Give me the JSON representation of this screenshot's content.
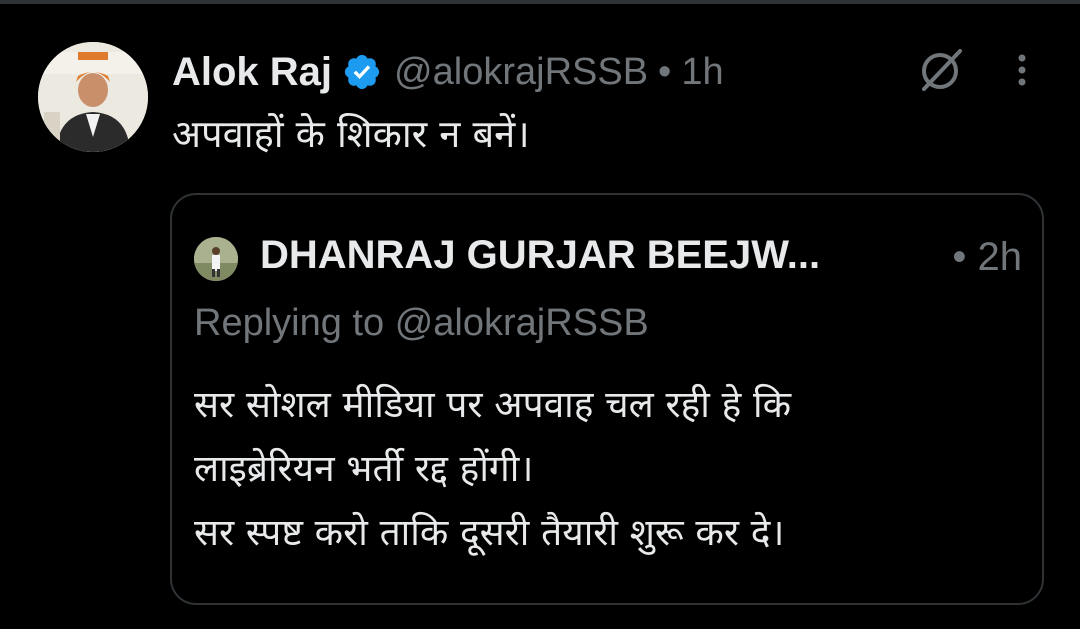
{
  "tweet": {
    "author_name": "Alok Raj",
    "author_handle": "@alokrajRSSB",
    "separator": "•",
    "time": "1h",
    "text": "अपवाहों के शिकार न बनें।",
    "icons": {
      "verified": "verified-badge-icon",
      "grok": "grok-icon",
      "more": "more-options-icon"
    },
    "colors": {
      "verified": "#1d9bf0",
      "muted": "#71767b",
      "text": "#e7e9ea",
      "border": "#2f3336"
    }
  },
  "quote": {
    "author_name": "DHANRAJ GURJAR BEEJW...",
    "separator": "•",
    "time": "2h",
    "reply_prefix": "Replying to",
    "reply_handle": "@alokrajRSSB",
    "lines": [
      "सर सोशल मीडिया पर अपवाह चल रही हे कि",
      "लाइब्रेरियन भर्ती रद्द होंगी।",
      "सर स्पष्ट करो ताकि दूसरी तैयारी शुरू कर दे।"
    ]
  }
}
